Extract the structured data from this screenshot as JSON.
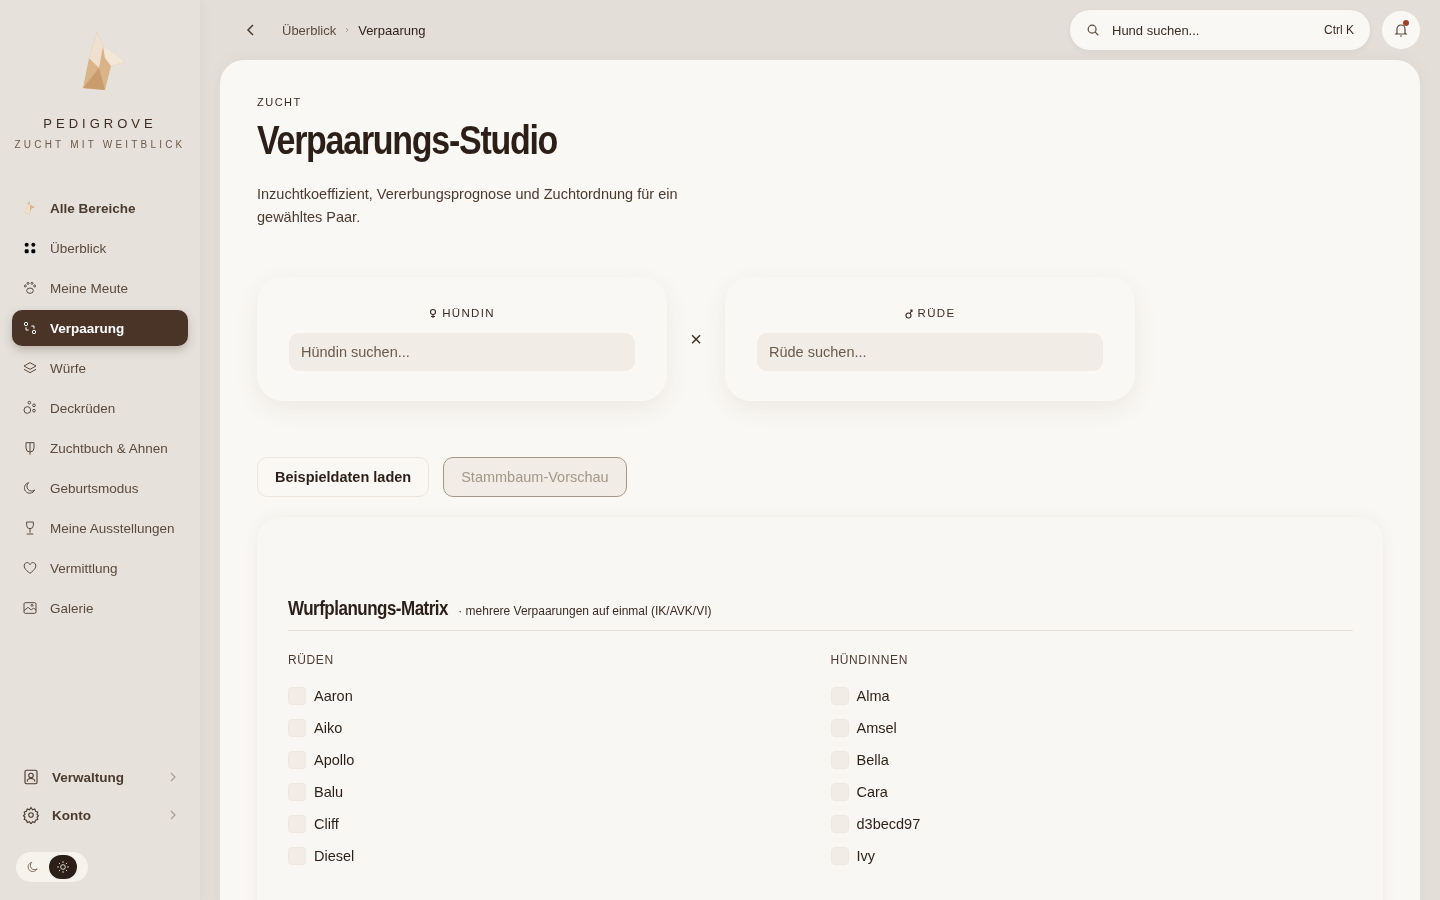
{
  "brand": {
    "name": "PEDIGROVE",
    "tagline": "ZUCHT MIT WEITBLICK"
  },
  "sidebar": {
    "items": [
      {
        "label": "Alle Bereiche",
        "selected": false,
        "strong": true
      },
      {
        "label": "Überblick",
        "selected": false,
        "strong": false
      },
      {
        "label": "Meine Meute",
        "selected": false,
        "strong": false
      },
      {
        "label": "Verpaarung",
        "selected": true,
        "strong": false
      },
      {
        "label": "Würfe",
        "selected": false,
        "strong": false
      },
      {
        "label": "Deckrüden",
        "selected": false,
        "strong": false
      },
      {
        "label": "Zuchtbuch & Ahnen",
        "selected": false,
        "strong": false
      },
      {
        "label": "Geburtsmodus",
        "selected": false,
        "strong": false
      },
      {
        "label": "Meine Ausstellungen",
        "selected": false,
        "strong": false
      },
      {
        "label": "Vermittlung",
        "selected": false,
        "strong": false
      },
      {
        "label": "Galerie",
        "selected": false,
        "strong": false
      }
    ],
    "footer_items": [
      {
        "label": "Verwaltung"
      },
      {
        "label": "Konto"
      }
    ],
    "theme_toggle": [
      {
        "kind": "dark",
        "selected": false
      },
      {
        "kind": "light",
        "selected": true
      }
    ]
  },
  "breadcrumb": [
    "Überblick",
    "Verpaarung"
  ],
  "search": {
    "placeholder": "Hund suchen...",
    "shortcut": "Ctrl K"
  },
  "notifications": {
    "unread": true
  },
  "page": {
    "eyebrow": "ZUCHT",
    "title": "Verpaarungs-Studio",
    "description": "Inzuchtkoeffizient, Vererbungsprognose und Zuchtordnung für ein gewähltes Paar."
  },
  "pair": {
    "female": {
      "label": "HÜNDIN",
      "placeholder": "Hündin suchen..."
    },
    "separator": "×",
    "male": {
      "label": "RÜDE",
      "placeholder": "Rüde suchen..."
    }
  },
  "actions": [
    {
      "label": "Beispieldaten laden",
      "disabled": false
    },
    {
      "label": "Stammbaum-Vorschau",
      "disabled": true
    }
  ],
  "matrix": {
    "title": "Wurfplanungs-Matrix",
    "subtitle": "· mehrere Verpaarungen auf einmal (IK/AVK/VI)",
    "columns": [
      {
        "heading": "RÜDEN",
        "dogs": [
          {
            "name": "Aaron",
            "checked": false
          },
          {
            "name": "Aiko",
            "checked": false
          },
          {
            "name": "Apollo",
            "checked": false
          },
          {
            "name": "Balu",
            "checked": false
          },
          {
            "name": "Cliff",
            "checked": false
          },
          {
            "name": "Diesel",
            "checked": false
          }
        ]
      },
      {
        "heading": "HÜNDINNEN",
        "dogs": [
          {
            "name": "Alma",
            "checked": false
          },
          {
            "name": "Amsel",
            "checked": false
          },
          {
            "name": "Bella",
            "checked": false
          },
          {
            "name": "Cara",
            "checked": false
          },
          {
            "name": "d3becd97",
            "checked": false
          },
          {
            "name": "Ivy",
            "checked": false
          }
        ]
      }
    ]
  }
}
